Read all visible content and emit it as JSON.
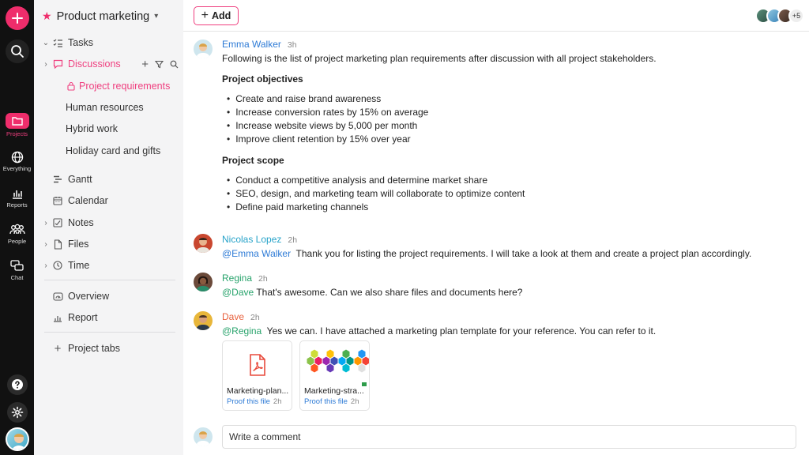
{
  "rail": {
    "items": [
      {
        "label": "Projects"
      },
      {
        "label": "Everything"
      },
      {
        "label": "Reports"
      },
      {
        "label": "People"
      },
      {
        "label": "Chat"
      }
    ],
    "active_color": "#ef2d6b"
  },
  "sidebar": {
    "project_title": "Product marketing",
    "items": [
      {
        "label": "Tasks"
      },
      {
        "label": "Discussions"
      },
      {
        "label": "Project requirements"
      },
      {
        "label": "Human resources"
      },
      {
        "label": "Hybrid work"
      },
      {
        "label": "Holiday card and gifts"
      },
      {
        "label": "Gantt"
      },
      {
        "label": "Calendar"
      },
      {
        "label": "Notes"
      },
      {
        "label": "Files"
      },
      {
        "label": "Time"
      },
      {
        "label": "Overview"
      },
      {
        "label": "Report"
      },
      {
        "label": "Project tabs"
      }
    ]
  },
  "topbar": {
    "add_label": "Add",
    "more_members": "+5"
  },
  "messages": [
    {
      "author": "Emma Walker",
      "author_color": "#2e7bd6",
      "time": "3h",
      "intro": "Following is the list of project marketing plan requirements after discussion with all project stakeholders.",
      "section1_title": "Project objectives",
      "section1_items": [
        "Create and raise brand awareness",
        "Increase conversion rates by 15% on average",
        "Increase website views by 5,000 per month",
        "Improve client retention by 15% over year"
      ],
      "section2_title": "Project scope",
      "section2_items": [
        "Conduct a competitive analysis and determine market share",
        "SEO, design, and marketing team will collaborate to optimize content",
        "Define paid marketing channels"
      ]
    },
    {
      "author": "Nicolas Lopez",
      "author_color": "#27a3c9",
      "time": "2h",
      "mention": "@Emma Walker",
      "text": "Thank you for listing the project requirements. I will take a look at them and create a project plan accordingly."
    },
    {
      "author": "Regina",
      "author_color": "#27a36b",
      "time": "2h",
      "mention": "@Dave",
      "text": "That's awesome. Can we also share files and documents here?"
    },
    {
      "author": "Dave",
      "author_color": "#e8603c",
      "time": "2h",
      "mention": "@Regina",
      "text": "Yes we can. I have attached a marketing plan template for your reference. You can refer to it."
    }
  ],
  "attachments": [
    {
      "name": "Marketing-plan...",
      "action": "Proof this file",
      "time": "2h",
      "icon": "pdf-icon"
    },
    {
      "name": "Marketing-stra...",
      "action": "Proof this file",
      "time": "2h",
      "icon": "image-thumbnail"
    }
  ],
  "comment": {
    "placeholder": "Write a comment"
  }
}
